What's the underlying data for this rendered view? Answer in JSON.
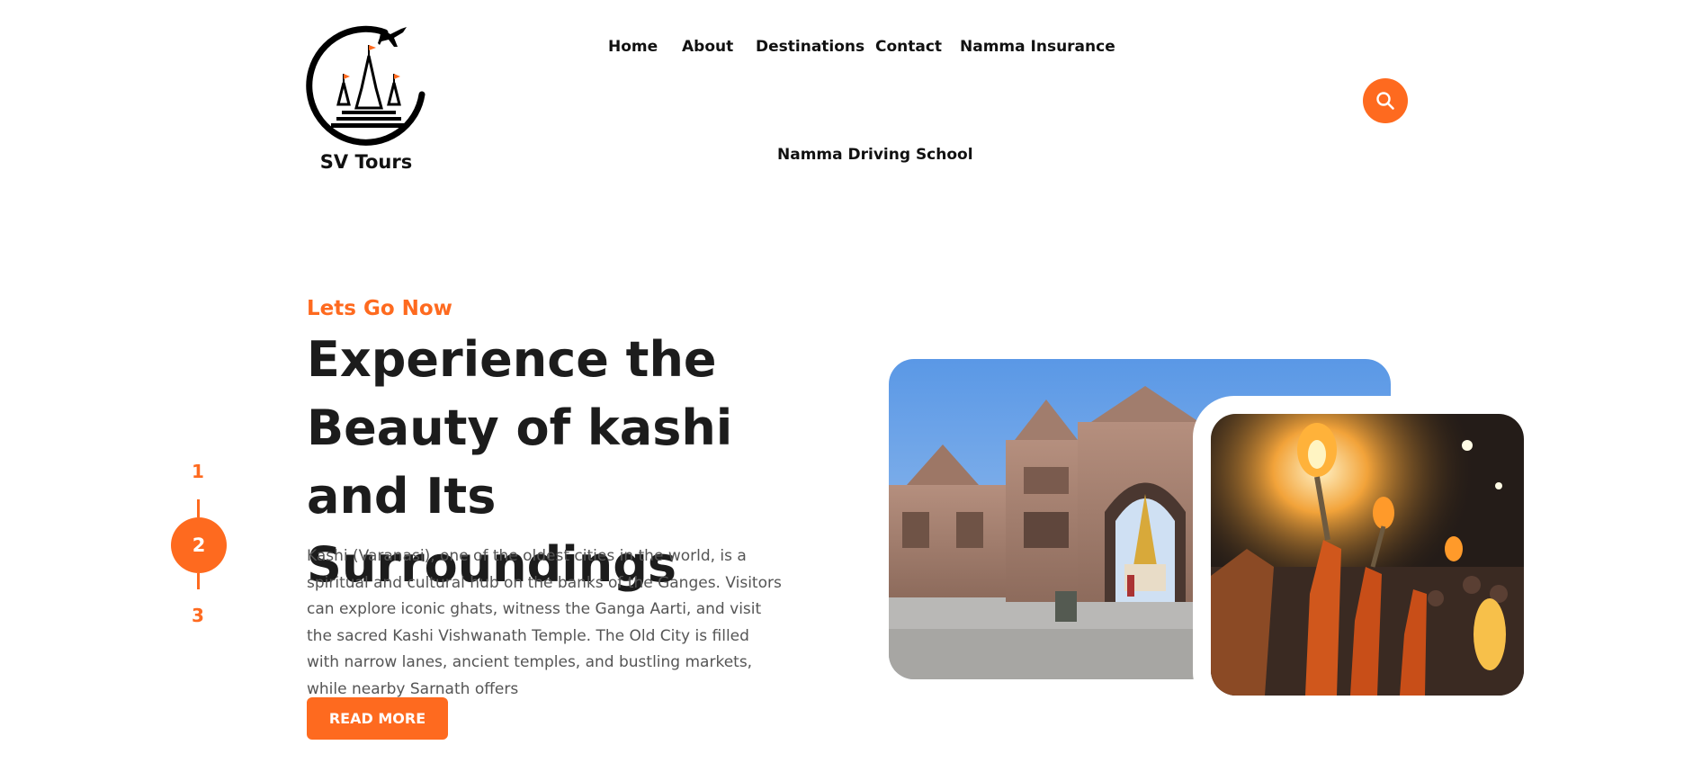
{
  "brand": {
    "name": "SV Tours",
    "logo_icon": "temple-plane-logo"
  },
  "nav": {
    "items": [
      {
        "label": "Home"
      },
      {
        "label": "About"
      },
      {
        "label": "Destinations"
      },
      {
        "label": "Contact"
      },
      {
        "label": "Namma Insurance"
      },
      {
        "label": "Namma Driving School"
      }
    ],
    "search_icon": "search-icon"
  },
  "slider": {
    "numbers": [
      "1",
      "2",
      "3"
    ],
    "active": "2"
  },
  "hero": {
    "eyebrow": "Lets Go Now",
    "title": "Experience the Beauty of kashi and Its Surroundings",
    "description": "Kashi (Varanasi), one of the oldest cities in the world, is a spiritual and cultural hub on the banks of the Ganges. Visitors can explore iconic ghats, witness the Ganga Aarti, and visit the sacred Kashi Vishwanath Temple. The Old City is filled with narrow lanes, ancient temples, and bustling markets, while nearby Sarnath offers",
    "button": "READ MORE"
  },
  "colors": {
    "accent": "#fe6a1f",
    "text": "#1c1c1c",
    "muted": "#555555"
  }
}
